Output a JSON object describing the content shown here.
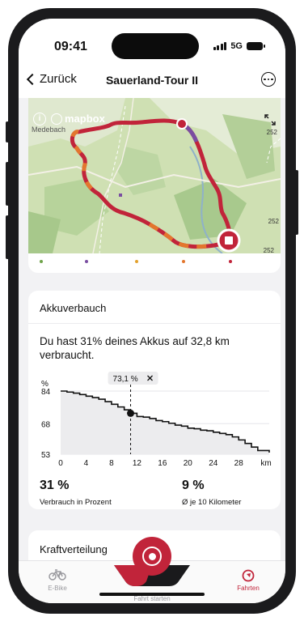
{
  "status_bar": {
    "time": "09:41",
    "network": "5G"
  },
  "nav": {
    "back_label": "Zurück",
    "title": "Sauerland-Tour II"
  },
  "map": {
    "attribution": "mapbox",
    "place_label": "Medebach",
    "road_labels": [
      "252",
      "252",
      "252"
    ],
    "route_color": "#c1243a"
  },
  "battery_card": {
    "title": "Akkuverbauch",
    "description": "Du hast 31% deines Akkus auf 32,8 km verbraucht.",
    "tooltip": "73,1 %",
    "stats": [
      {
        "value": "31 %",
        "label": "Verbrauch in Prozent"
      },
      {
        "value": "9 %",
        "label": "Ø je 10 Kilometer"
      }
    ]
  },
  "chart_data": {
    "type": "line",
    "title": "",
    "ylabel": "%",
    "xlabel": "km",
    "x_ticks": [
      "0",
      "4",
      "8",
      "12",
      "16",
      "20",
      "24",
      "28",
      "km"
    ],
    "y_ticks": [
      "84",
      "68",
      "53"
    ],
    "xlim": [
      0,
      32.8
    ],
    "ylim": [
      53,
      84
    ],
    "series": [
      {
        "x": [
          0,
          1,
          2,
          3,
          4,
          5,
          6,
          7,
          8,
          9,
          10,
          11,
          12,
          13,
          14,
          15,
          16,
          17,
          18,
          19,
          20,
          21,
          22,
          23,
          24,
          25,
          26,
          27,
          28,
          29,
          30,
          31,
          32.8
        ],
        "y": [
          84,
          83.5,
          83,
          82.3,
          81.5,
          80.8,
          80,
          78.8,
          77.5,
          76.2,
          74.8,
          73.1,
          71.5,
          71.2,
          70.5,
          69.5,
          69,
          68.2,
          67.3,
          66.8,
          65.8,
          65.5,
          64.8,
          64.5,
          63.8,
          63.2,
          62.6,
          61.5,
          60,
          58.3,
          56.5,
          54.8,
          53.8
        ]
      }
    ],
    "marker": {
      "x": 11,
      "y": 73.1
    }
  },
  "force_card": {
    "title": "Kraftverteilung"
  },
  "tab_bar": {
    "tabs": [
      {
        "label": "E-Bike",
        "icon": "bike-icon"
      },
      {
        "label": "Fahrt starten",
        "icon": "record-icon"
      },
      {
        "label": "Fahrten",
        "icon": "compass-icon"
      }
    ]
  },
  "colors": {
    "accent": "#c1243a",
    "background": "#f2f2f4"
  }
}
